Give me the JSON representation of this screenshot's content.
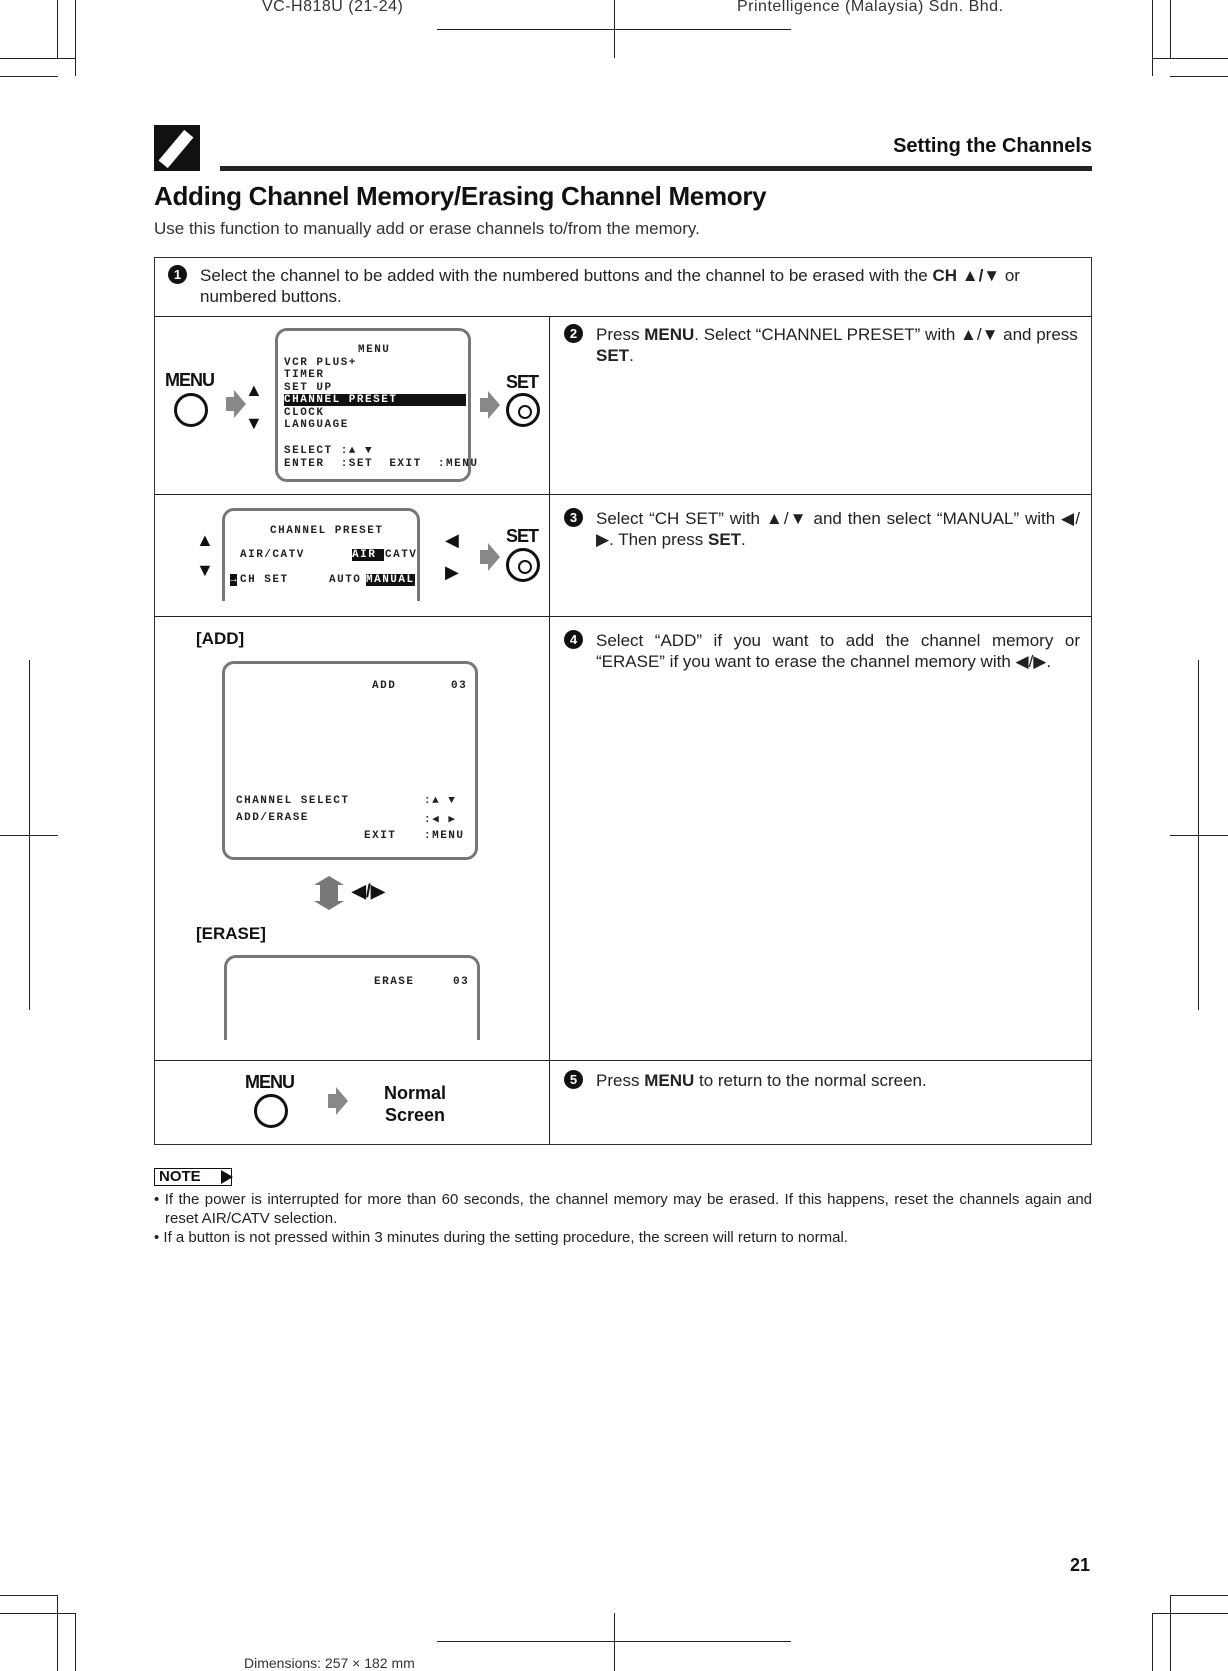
{
  "print_header": {
    "left": "VC-H818U (21-24)",
    "right": "Printelligence (Malaysia) Sdn. Bhd."
  },
  "section": "Setting the Channels",
  "title": "Adding Channel Memory/Erasing Channel Memory",
  "subtitle": "Use this function to manually add or erase channels to/from the memory.",
  "steps": [
    {
      "num": "1",
      "pre": "Select the channel to be added with the numbered buttons and the channel to be erased with the ",
      "bold": "CH ▲/▼",
      "post": " or numbered buttons."
    },
    {
      "num": "2",
      "pre": "Press ",
      "bold": "MENU",
      "mid": ". Select “CHANNEL PRESET” with ▲/▼ and press ",
      "bold2": "SET",
      "post": "."
    },
    {
      "num": "3",
      "pre": "Select “CH SET” with ▲/▼ and then select “MANUAL” with ◀/▶. Then press ",
      "bold": "SET",
      "post": "."
    },
    {
      "num": "4",
      "text": "Select “ADD” if you want to add the channel memory or “ERASE” if you want to erase the channel memory with ◀/▶."
    },
    {
      "num": "5",
      "pre": "Press ",
      "bold": "MENU",
      "post": " to return to the normal screen."
    }
  ],
  "buttons": {
    "menu": "MENU",
    "set": "SET",
    "up": "▲",
    "down": "▼",
    "left": "◀",
    "right": "▶",
    "left_right": "◀/▶"
  },
  "menu_osd": {
    "title": "MENU",
    "items": [
      "VCR PLUS+",
      "TIMER",
      "SET UP",
      "CHANNEL PRESET",
      "CLOCK",
      "LANGUAGE"
    ],
    "selected": "CHANNEL PRESET",
    "select": "SELECT :▲ ▼",
    "enter": "ENTER  :SET  EXIT  :MENU"
  },
  "preset_osd": {
    "title": "CHANNEL PRESET",
    "row1_label": "AIR/CATV",
    "row1_opt1": "AIR ",
    "row1_opt2": "CATV",
    "row2_cursor": "→",
    "row2_label": "CH SET",
    "row2_opt1": "AUTO",
    "row2_opt2": "MANUAL"
  },
  "add_label": "[ADD]",
  "erase_label": "[ERASE]",
  "add_osd": {
    "mode": "ADD",
    "channel": "03",
    "l1": "CHANNEL SELECT",
    "v1": ":▲ ▼",
    "l2": "ADD/ERASE",
    "v2": ":◀ ▶",
    "l3": "EXIT",
    "v3": ":MENU"
  },
  "erase_osd": {
    "mode": "ERASE",
    "channel": "03"
  },
  "normal_screen": [
    "Normal",
    "Screen"
  ],
  "note_label": "NOTE",
  "notes": [
    "If the power is interrupted for more than 60 seconds, the channel memory may be erased. If this happens, reset the channels again and reset AIR/CATV selection.",
    "If a button is not pressed within 3 minutes during the setting procedure, the screen will return to normal."
  ],
  "page_number": "21",
  "footer": "Dimensions: 257 × 182 mm"
}
